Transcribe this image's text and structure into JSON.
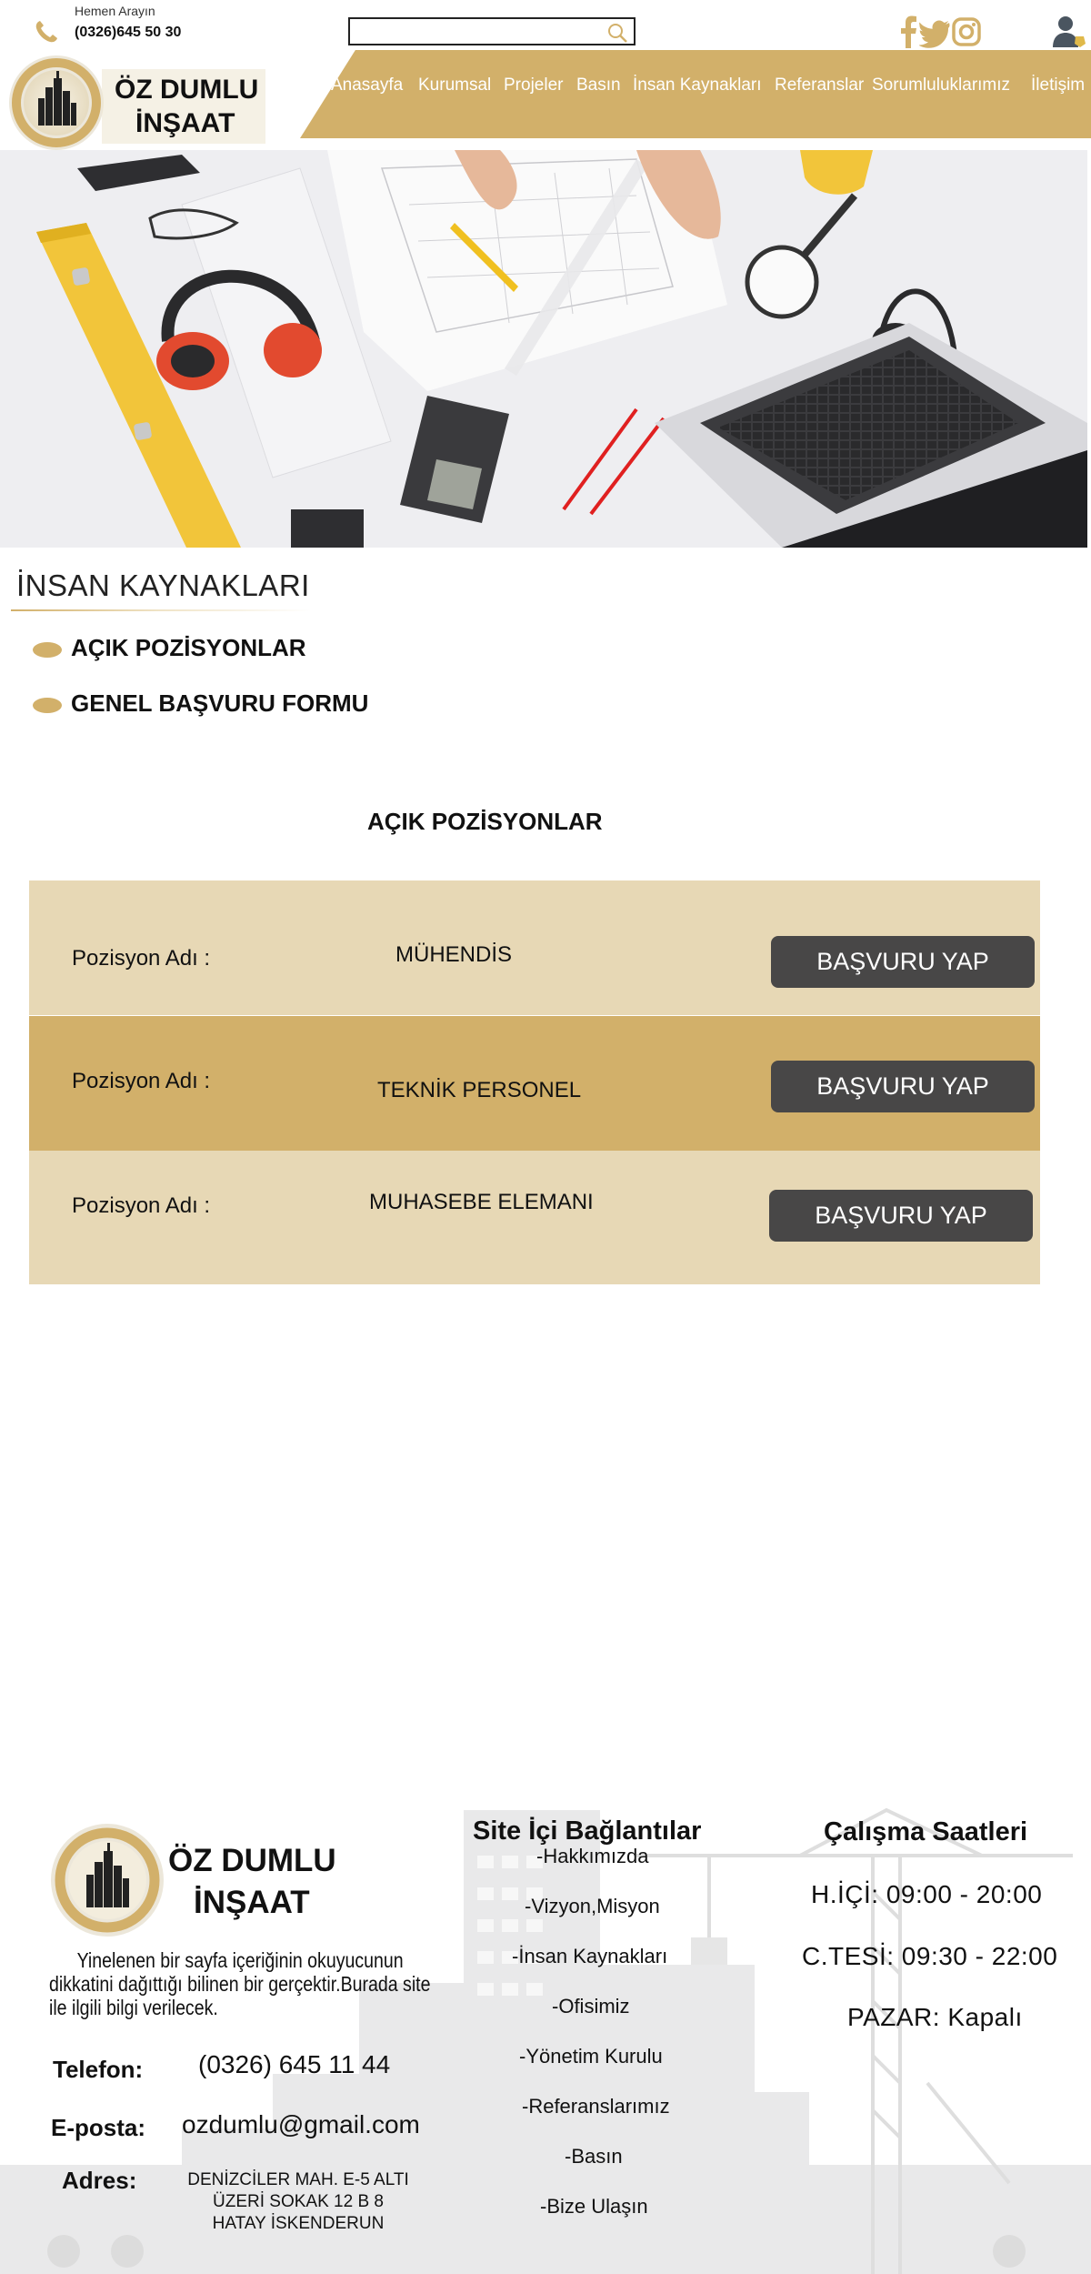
{
  "topbar": {
    "call_label": "Hemen Arayın",
    "phone": "(0326)645 50 30",
    "search_placeholder": ""
  },
  "brand": {
    "line1": "ÖZ DUMLU",
    "line2": "İNŞAAT"
  },
  "nav": {
    "items": [
      "Anasayfa",
      "Kurumsal",
      "Projeler",
      "Basın",
      "İnsan Kaynakları",
      "Referanslar",
      "Sorumluluklarımız",
      "İletişim"
    ]
  },
  "section": {
    "title": "İNSAN KAYNAKLARI",
    "links": [
      "AÇIK POZİSYONLAR",
      "GENEL BAŞVURU FORMU"
    ]
  },
  "positions": {
    "heading": "AÇIK POZİSYONLAR",
    "label": "Pozisyon Adı :",
    "apply_label": "BAŞVURU YAP",
    "items": [
      "MÜHENDİS",
      "TEKNİK PERSONEL",
      "MUHASEBE ELEMANI"
    ]
  },
  "footer": {
    "description": "Yinelenen bir sayfa içeriğinin okuyucunun dikkatini dağıttığı bilinen bir gerçektir.Burada site ile ilgili  bilgi verilecek.",
    "phone_label": "Telefon:",
    "phone_value": "(0326) 645 11 44",
    "email_label": "E-posta:",
    "email_value": "ozdumlu@gmail.com",
    "address_label": "Adres:",
    "address_lines": [
      "DENİZCİLER MAH. E-5 ALTI",
      "ÜZERİ SOKAK 12 B 8",
      "HATAY İSKENDERUN"
    ],
    "links_title": "Site İçi Bağlantılar",
    "links": [
      "-Hakkımızda",
      "-Vizyon,Misyon",
      "-İnsan Kaynakları",
      "-Ofisimiz",
      "-Yönetim Kurulu",
      "-Referanslarımız",
      "-Basın",
      "-Bize Ulaşın"
    ],
    "hours_title": "Çalışma Saatleri",
    "hours": [
      "H.İÇİ: 09:00 - 20:00",
      "C.TESİ: 09:30 - 22:00",
      "PAZAR: Kapalı"
    ]
  },
  "colors": {
    "accent": "#d2b06a",
    "row_light": "#e7d8b5",
    "button": "#484747"
  }
}
